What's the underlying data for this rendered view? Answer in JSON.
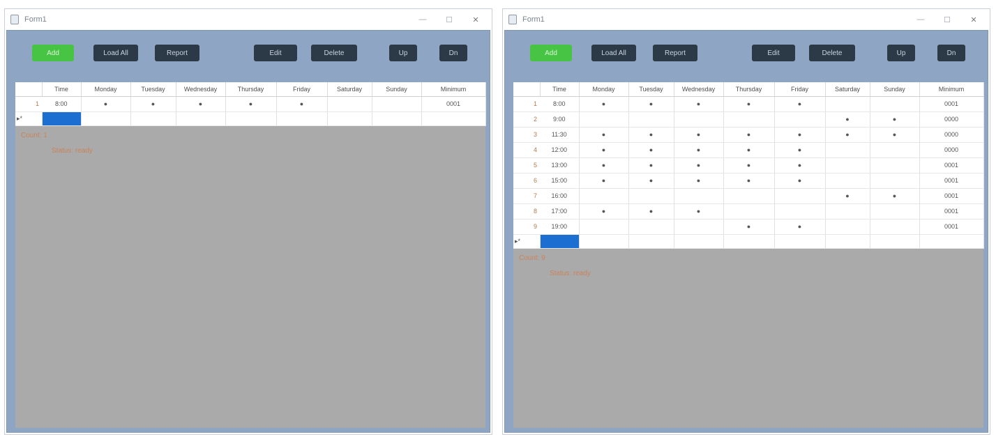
{
  "windows": [
    {
      "title": "Form1",
      "controls": {
        "minimize": "—",
        "maximize": "☐",
        "close": "✕"
      },
      "toolbar": [
        {
          "id": "add",
          "label": "Add",
          "style": "green"
        },
        {
          "id": "load",
          "label": "Load All",
          "style": "dark"
        },
        {
          "id": "report",
          "label": "Report",
          "style": "dark"
        },
        {
          "id": "edit",
          "label": "Edit",
          "style": "dark"
        },
        {
          "id": "delete",
          "label": "Delete",
          "style": "dark"
        },
        {
          "id": "up",
          "label": "Up",
          "style": "dark"
        },
        {
          "id": "down",
          "label": "Dn",
          "style": "dark"
        }
      ],
      "columns": [
        "",
        "Time",
        "Monday",
        "Tuesday",
        "Wednesday",
        "Thursday",
        "Friday",
        "Saturday",
        "Sunday",
        "Minimum"
      ],
      "rows": [
        [
          "1",
          "8:00",
          "●",
          "●",
          "●",
          "●",
          "●",
          "",
          "",
          "0001"
        ]
      ],
      "new_row_marker": "▸*",
      "lower_texts": [
        "Count: 1",
        "Status: ready"
      ]
    },
    {
      "title": "Form1",
      "controls": {
        "minimize": "—",
        "maximize": "☐",
        "close": "✕"
      },
      "toolbar": [
        {
          "id": "add",
          "label": "Add",
          "style": "green"
        },
        {
          "id": "load",
          "label": "Load All",
          "style": "dark"
        },
        {
          "id": "report",
          "label": "Report",
          "style": "dark"
        },
        {
          "id": "edit",
          "label": "Edit",
          "style": "dark"
        },
        {
          "id": "delete",
          "label": "Delete",
          "style": "dark"
        },
        {
          "id": "up",
          "label": "Up",
          "style": "dark"
        },
        {
          "id": "down",
          "label": "Dn",
          "style": "dark"
        }
      ],
      "columns": [
        "",
        "Time",
        "Monday",
        "Tuesday",
        "Wednesday",
        "Thursday",
        "Friday",
        "Saturday",
        "Sunday",
        "Minimum"
      ],
      "rows": [
        [
          "1",
          "8:00",
          "●",
          "●",
          "●",
          "●",
          "●",
          "",
          "",
          "0001"
        ],
        [
          "2",
          "9:00",
          "",
          "",
          "",
          "",
          "",
          "●",
          "●",
          "0000"
        ],
        [
          "3",
          "11:30",
          "●",
          "●",
          "●",
          "●",
          "●",
          "●",
          "●",
          "0000"
        ],
        [
          "4",
          "12:00",
          "●",
          "●",
          "●",
          "●",
          "●",
          "",
          "",
          "0000"
        ],
        [
          "5",
          "13:00",
          "●",
          "●",
          "●",
          "●",
          "●",
          "",
          "",
          "0001"
        ],
        [
          "6",
          "15:00",
          "●",
          "●",
          "●",
          "●",
          "●",
          "",
          "",
          "0001"
        ],
        [
          "7",
          "16:00",
          "",
          "",
          "",
          "",
          "",
          "●",
          "●",
          "0001"
        ],
        [
          "8",
          "17:00",
          "●",
          "●",
          "●",
          "",
          "",
          "",
          "",
          "0001"
        ],
        [
          "9",
          "19:00",
          "",
          "",
          "",
          "●",
          "●",
          "",
          "",
          "0001"
        ]
      ],
      "new_row_marker": "▸*",
      "lower_texts": [
        "Count: 9",
        "Status: ready"
      ]
    }
  ]
}
